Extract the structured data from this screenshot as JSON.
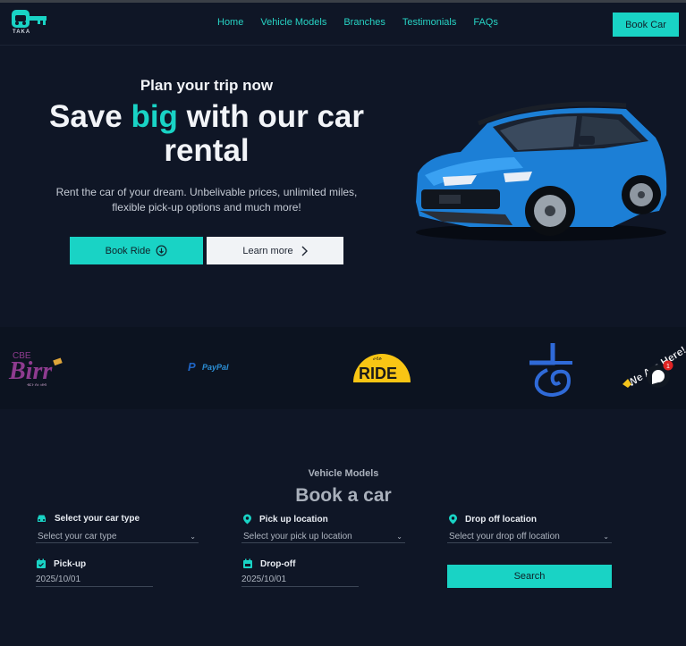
{
  "brand": {
    "logo_text": "TAKA"
  },
  "nav": {
    "links": [
      "Home",
      "Vehicle Models",
      "Branches",
      "Testimonials",
      "FAQs"
    ],
    "cta": "Book Car"
  },
  "hero": {
    "subtitle": "Plan your trip now",
    "title_part1": "Save ",
    "title_accent": "big",
    "title_part2": " with our car rental",
    "description": "Rent the car of your dream. Unbelivable prices, unlimited miles, flexible pick-up options and much more!",
    "book_ride_label": "Book Ride",
    "learn_more_label": "Learn more"
  },
  "partners": {
    "cbe_top": "CBE",
    "cbe_main": "Birr",
    "cbe_small": "ብርን ያለ ገደብ",
    "paypal": "PayPal",
    "ride": "RIDE",
    "ride_small": "ራይድ"
  },
  "chat_widget": {
    "label": "We Are Here!",
    "unread": "1"
  },
  "booking": {
    "section_label": "Vehicle Models",
    "section_title": "Book a car",
    "car_type": {
      "label": "Select your car type",
      "placeholder": "Select your car type"
    },
    "pickup_location": {
      "label": "Pick up location",
      "placeholder": "Select your pick up location"
    },
    "dropoff_location": {
      "label": "Drop off location",
      "placeholder": "Select your drop off location"
    },
    "pickup_date": {
      "label": "Pick-up",
      "value": "2025/10/01"
    },
    "dropoff_date": {
      "label": "Drop-off",
      "value": "2025/10/01"
    },
    "search_label": "Search"
  },
  "colors": {
    "accent": "#19d3c5",
    "background": "#0f1626",
    "button_light": "#f1f3f6"
  }
}
